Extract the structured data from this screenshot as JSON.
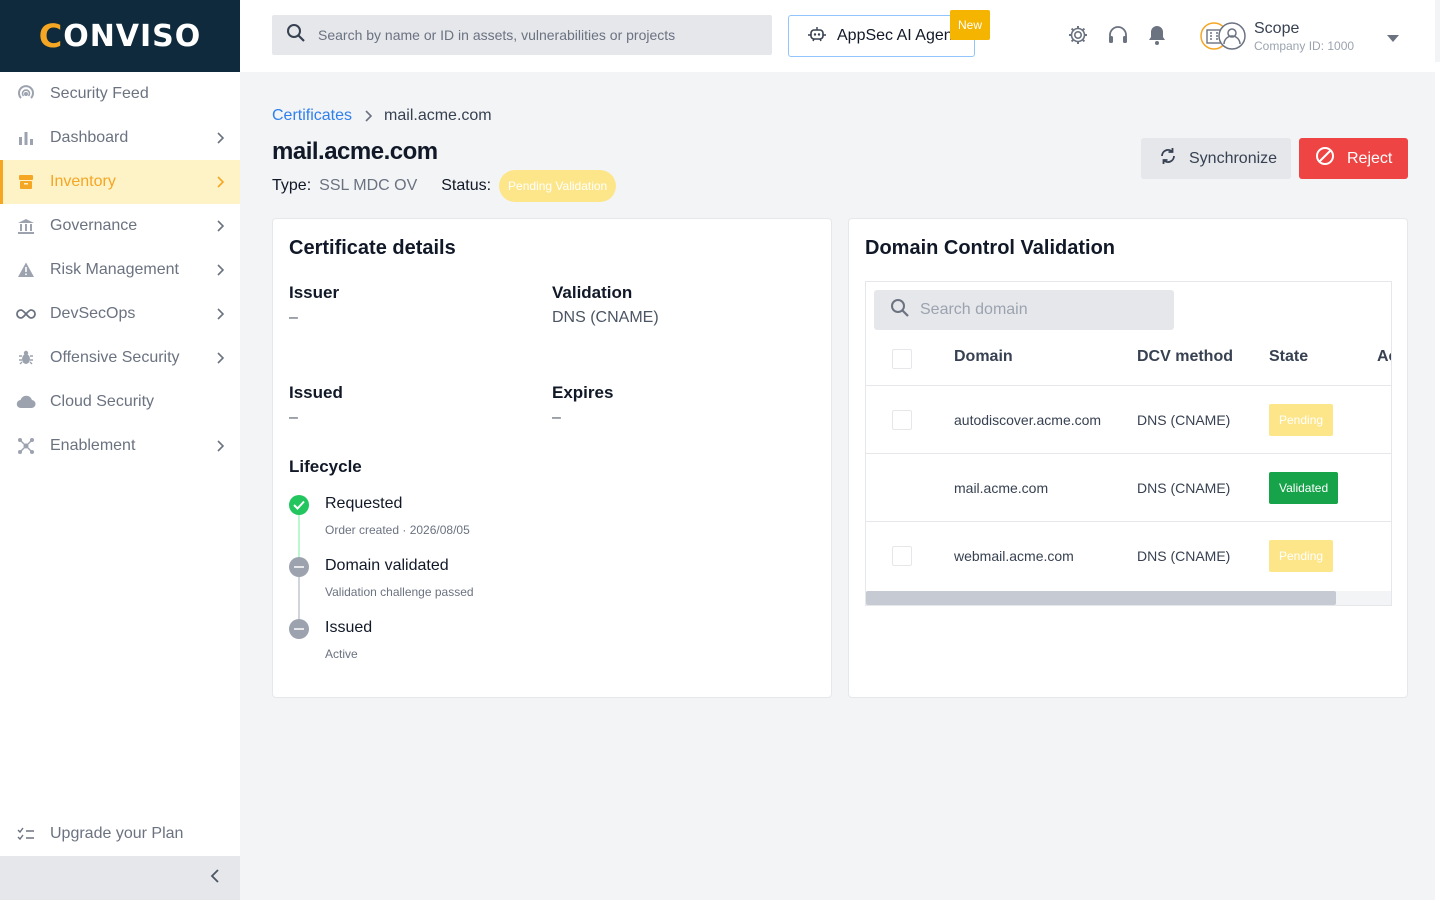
{
  "brand": {
    "name": "ONVISO",
    "letter": "C",
    "accent": "#f5a623",
    "navy": "#0e2a3c"
  },
  "sidebar": {
    "items": [
      {
        "label": "Security Feed",
        "icon": "radar-icon",
        "chevron": false
      },
      {
        "label": "Dashboard",
        "icon": "bar-chart-icon",
        "chevron": true
      },
      {
        "label": "Inventory",
        "icon": "archive-icon",
        "chevron": true,
        "active": true
      },
      {
        "label": "Governance",
        "icon": "bank-icon",
        "chevron": true
      },
      {
        "label": "Risk Management",
        "icon": "warning-icon",
        "chevron": true
      },
      {
        "label": "DevSecOps",
        "icon": "infinity-icon",
        "chevron": true
      },
      {
        "label": "Offensive Security",
        "icon": "bug-icon",
        "chevron": true
      },
      {
        "label": "Cloud Security",
        "icon": "cloud-icon",
        "chevron": false
      },
      {
        "label": "Enablement",
        "icon": "network-icon",
        "chevron": true
      }
    ],
    "upgrade_label": "Upgrade your Plan"
  },
  "topbar": {
    "search_placeholder": "Search by name or ID in assets, vulnerabilities or projects",
    "ai_label": "AppSec AI Agent",
    "new_badge": "New",
    "scope_name": "Scope",
    "scope_company": "Company ID: 1000"
  },
  "breadcrumb": {
    "parent": "Certificates",
    "current": "mail.acme.com"
  },
  "page": {
    "title": "mail.acme.com",
    "type_label": "Type:",
    "type_value": "SSL MDC OV",
    "status_label": "Status:",
    "status_value": "Pending Validation",
    "sync_label": "Synchronize",
    "reject_label": "Reject"
  },
  "details": {
    "title": "Certificate details",
    "issuer_label": "Issuer",
    "issuer_value": "–",
    "validation_label": "Validation",
    "validation_value": "DNS (CNAME)",
    "issued_label": "Issued",
    "issued_value": "–",
    "expires_label": "Expires",
    "expires_value": "–",
    "lifecycle_title": "Lifecycle",
    "lifecycle": [
      {
        "name": "Requested",
        "sub": "Order created · 2026/08/05",
        "state": "done"
      },
      {
        "name": "Domain validated",
        "sub": "Validation challenge passed",
        "state": "pending"
      },
      {
        "name": "Issued",
        "sub": "Active",
        "state": "pending"
      }
    ]
  },
  "dcv": {
    "title": "Domain Control Validation",
    "search_placeholder": "Search domain",
    "columns": [
      "Domain",
      "DCV method",
      "State",
      "Actions"
    ],
    "rows": [
      {
        "domain": "autodiscover.acme.com",
        "method": "DNS (CNAME)",
        "state": "Pending",
        "checkbox": true
      },
      {
        "domain": "mail.acme.com",
        "method": "DNS (CNAME)",
        "state": "Validated",
        "checkbox": false
      },
      {
        "domain": "webmail.acme.com",
        "method": "DNS (CNAME)",
        "state": "Pending",
        "checkbox": true
      }
    ]
  }
}
